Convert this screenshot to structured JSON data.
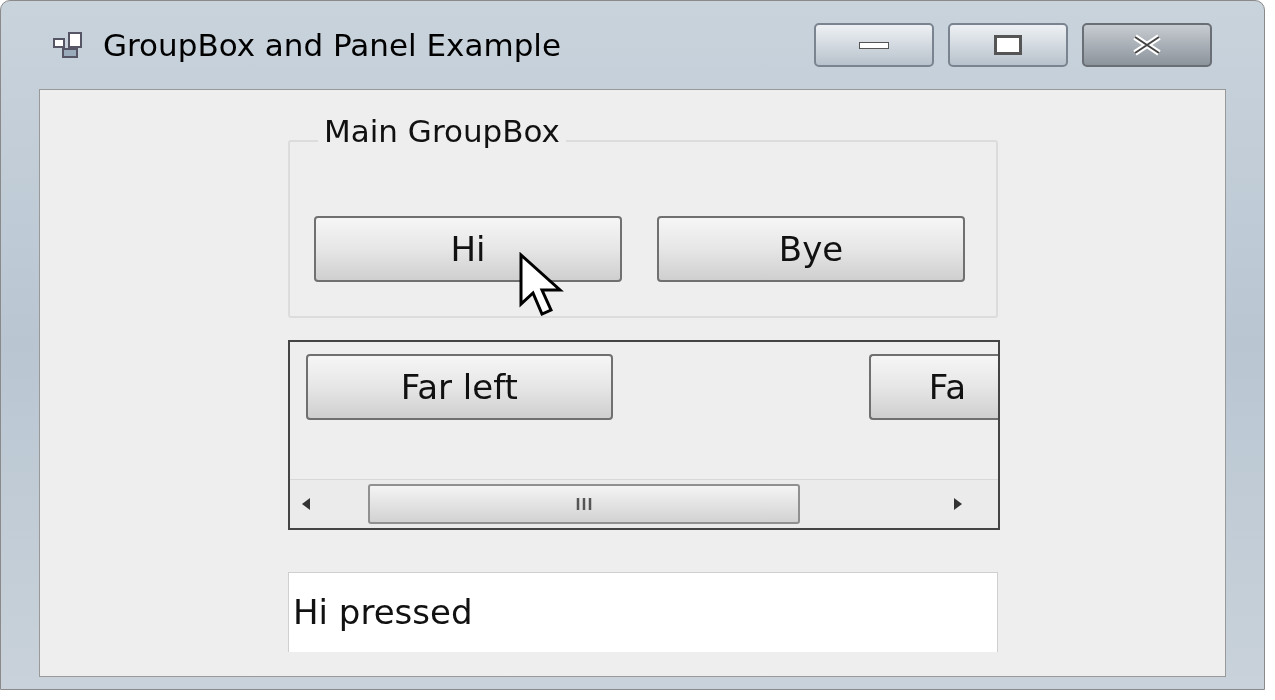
{
  "window": {
    "title": "GroupBox and Panel Example"
  },
  "group_box": {
    "label": "Main GroupBox",
    "buttons": [
      "Hi",
      "Bye"
    ]
  },
  "panel": {
    "buttons": [
      "Far left",
      "Fa"
    ]
  },
  "output": {
    "value": "Hi pressed"
  }
}
